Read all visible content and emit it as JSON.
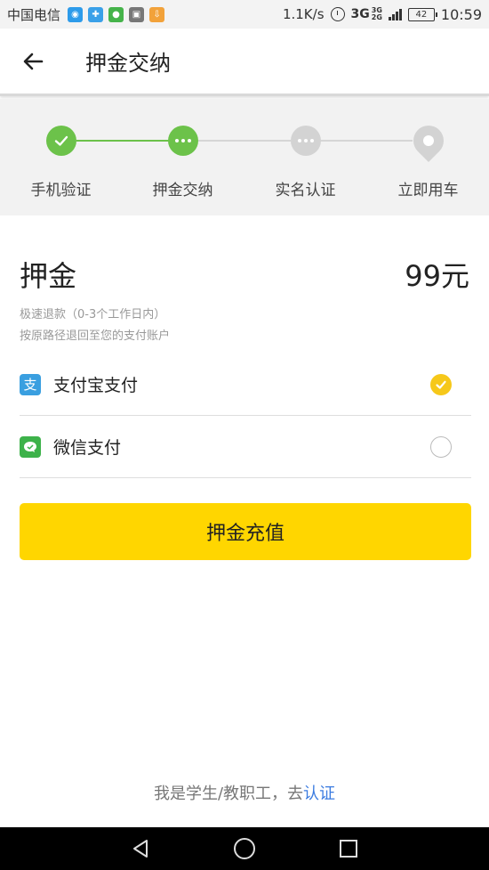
{
  "status_bar": {
    "carrier": "中国电信",
    "net_speed": "1.1K/s",
    "network": "3G",
    "network_sub": "2G",
    "battery": "42",
    "time": "10:59"
  },
  "header": {
    "title": "押金交纳"
  },
  "stepper": {
    "steps": [
      {
        "label": "手机验证",
        "state": "done"
      },
      {
        "label": "押金交纳",
        "state": "active"
      },
      {
        "label": "实名认证",
        "state": "todo"
      },
      {
        "label": "立即用车",
        "state": "todo"
      }
    ]
  },
  "deposit": {
    "title": "押金",
    "amount": "99元",
    "note_1": "极速退款（0-3个工作日内）",
    "note_2": "按原路径退回至您的支付账户"
  },
  "payment_methods": [
    {
      "label": "支付宝支付",
      "icon": "alipay-icon",
      "selected": true
    },
    {
      "label": "微信支付",
      "icon": "wechat-pay-icon",
      "selected": false
    }
  ],
  "cta_label": "押金充值",
  "footer": {
    "prefix": "我是学生/教职工，去",
    "link": "认证"
  },
  "colors": {
    "accent": "#ffd600",
    "step_green": "#6cc24a",
    "link_blue": "#3a7be0"
  }
}
